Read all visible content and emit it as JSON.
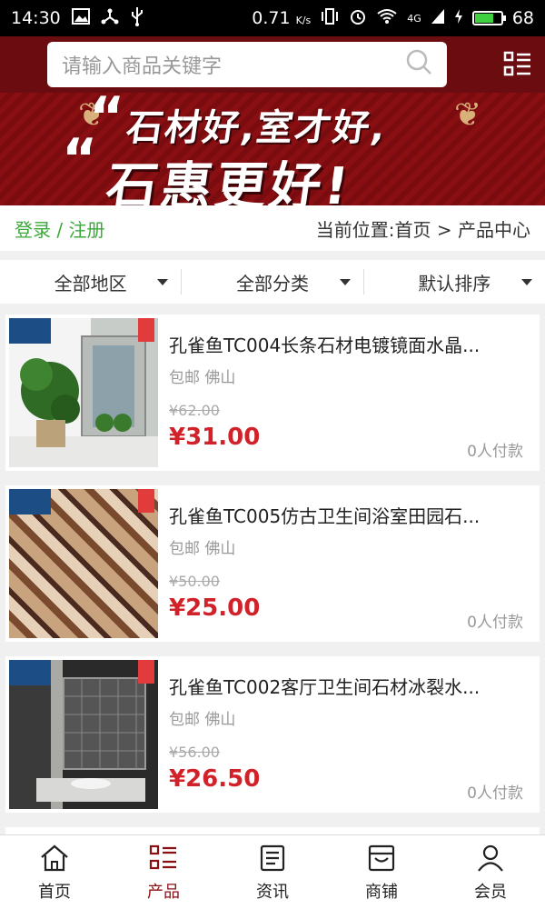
{
  "status": {
    "time": "14:30",
    "speed": "0.71",
    "speed_unit": "K/s",
    "network": "4G",
    "battery": "68"
  },
  "header": {
    "search_placeholder": "请输入商品关键字"
  },
  "banner": {
    "line1": "石材好,室才好,",
    "line2": "石惠更好!"
  },
  "crumbs": {
    "login": "登录 / 注册",
    "location": "当前位置:首页 > 产品中心"
  },
  "filters": [
    {
      "label": "全部地区"
    },
    {
      "label": "全部分类"
    },
    {
      "label": "默认排序"
    }
  ],
  "products": [
    {
      "title": "孔雀鱼TC004长条石材电镀镜面水晶...",
      "meta": "包邮 佛山",
      "old_price": "¥62.00",
      "price": "¥31.00",
      "sold": "0人付款"
    },
    {
      "title": "孔雀鱼TC005仿古卫生间浴室田园石...",
      "meta": "包邮 佛山",
      "old_price": "¥50.00",
      "price": "¥25.00",
      "sold": "0人付款"
    },
    {
      "title": "孔雀鱼TC002客厅卫生间石材冰裂水...",
      "meta": "包邮 佛山",
      "old_price": "¥56.00",
      "price": "¥26.50",
      "sold": "0人付款"
    }
  ],
  "tabs": [
    {
      "label": "首页",
      "icon": "home-icon"
    },
    {
      "label": "产品",
      "icon": "product-list-icon",
      "active": true
    },
    {
      "label": "资讯",
      "icon": "news-icon"
    },
    {
      "label": "商铺",
      "icon": "store-icon"
    },
    {
      "label": "会员",
      "icon": "user-icon"
    }
  ],
  "colors": {
    "brand": "#6b0d10",
    "price": "#d1222a",
    "link": "#3aa83a"
  }
}
